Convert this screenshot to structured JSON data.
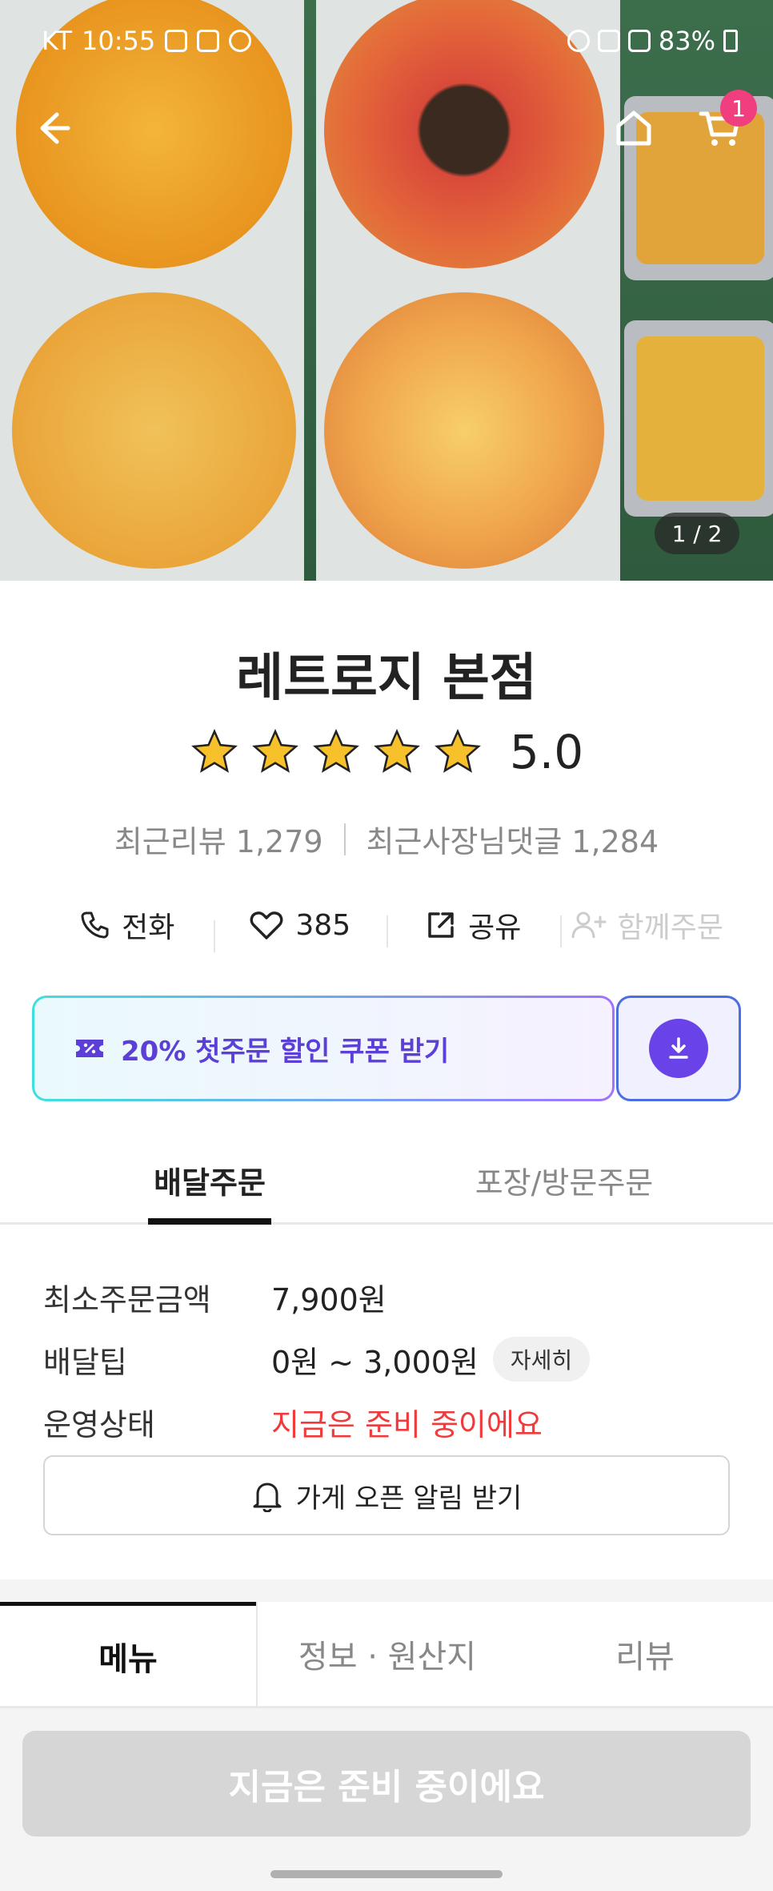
{
  "status_bar": {
    "carrier": "KT",
    "time": "10:55",
    "battery": "83%"
  },
  "hero": {
    "pager": "1 / 2",
    "cart_count": "1"
  },
  "store": {
    "name": "레트로지 본점",
    "rating": "5.0",
    "recent_reviews": "최근리뷰 1,279",
    "owner_replies": "최근사장님댓글 1,284"
  },
  "actions": {
    "call": "전화",
    "likes": "385",
    "share": "공유",
    "group_order": "함께주문"
  },
  "coupon": {
    "label": "20% 첫주문 할인 쿠폰 받기"
  },
  "order_tabs": {
    "delivery": "배달주문",
    "pickup": "포장/방문주문"
  },
  "info": {
    "min_order_label": "최소주문금액",
    "min_order_value": "7,900원",
    "delivery_tip_label": "배달팁",
    "delivery_tip_value": "0원 ~ 3,000원",
    "detail_label": "자세히",
    "status_label": "운영상태",
    "status_value": "지금은 준비 중이에요",
    "notify_label": "가게 오픈 알림 받기"
  },
  "menu_tabs": {
    "menu": "메뉴",
    "info": "정보 · 원산지",
    "review": "리뷰"
  },
  "cta": {
    "label": "지금은 준비 중이에요"
  },
  "colors": {
    "accent_purple": "#6a43e8",
    "status_red": "#ef3b3b",
    "badge_pink": "#f03e7e"
  }
}
